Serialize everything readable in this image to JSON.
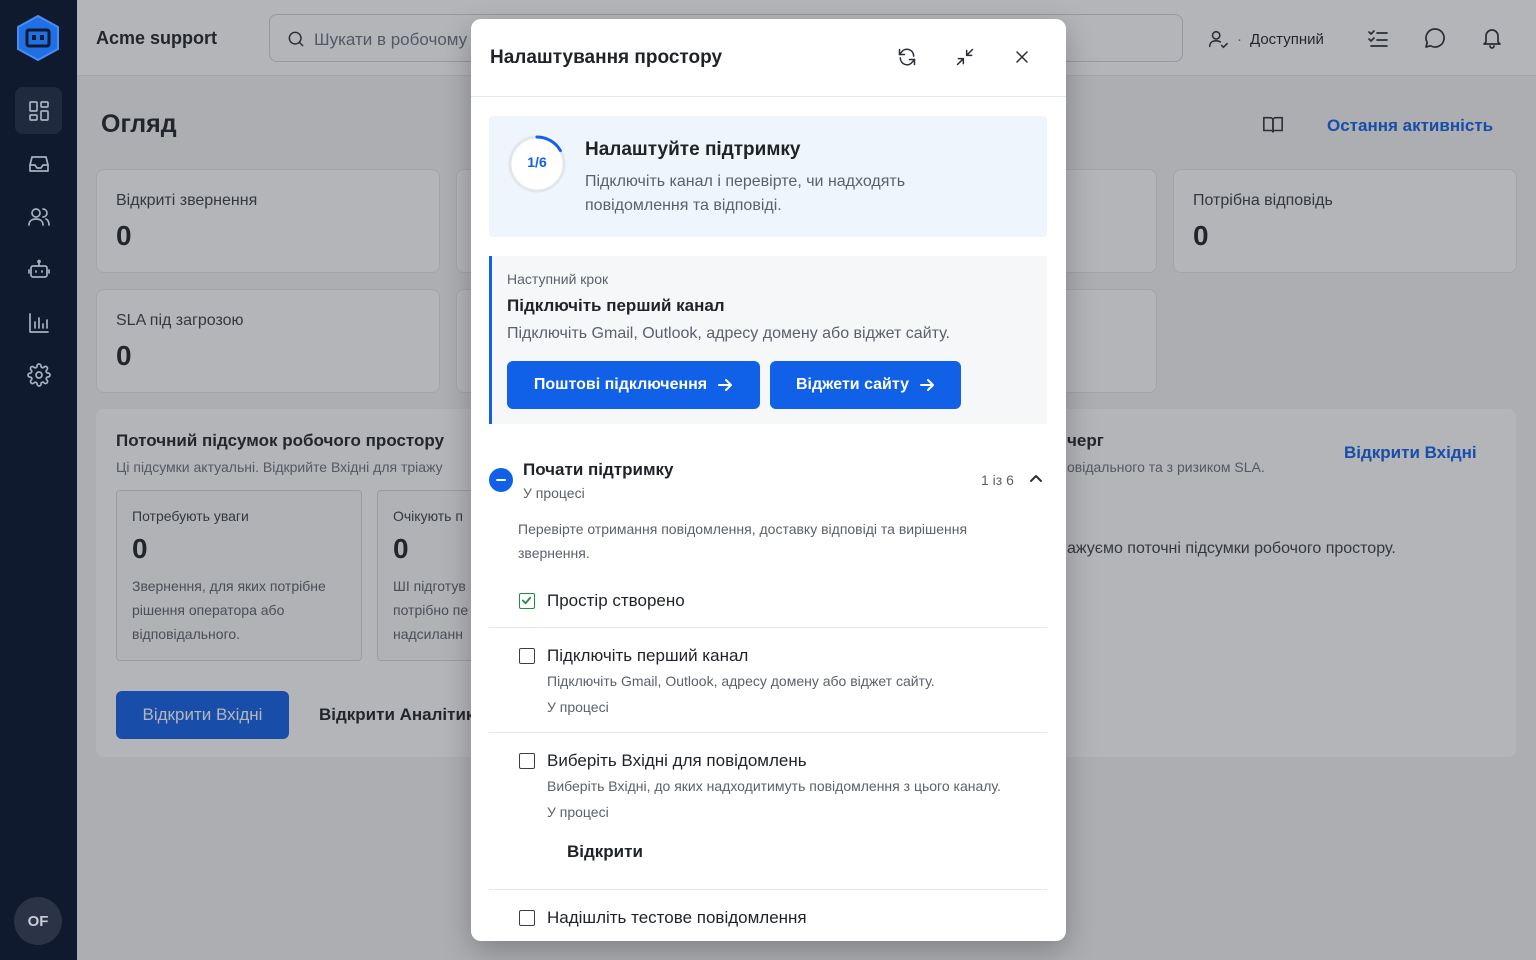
{
  "app": {
    "name": "Acme support",
    "user_initials": "OF"
  },
  "search": {
    "placeholder": "Шукати в робочому просторі"
  },
  "header": {
    "status": "Доступний"
  },
  "page": {
    "title": "Огляд",
    "recent_activity_link": "Остання активність"
  },
  "cards": [
    {
      "label": "Відкриті звернення",
      "value": "0"
    },
    {
      "label": "Потрібна відповідь",
      "value": "0"
    },
    {
      "label": "SLA під загрозою",
      "value": "0"
    }
  ],
  "summary": {
    "title": "Поточний підсумок робочого простору",
    "subtitle": "Ці підсумки актуальні. Відкрийте Вхідні для тріажу",
    "right_title": "черг",
    "right_subtitle": "овідального та з ризиком SLA.",
    "right_text": "ажуємо поточні підсумки робочого простору.",
    "open_inbox_link": "Відкрити Вхідні",
    "minis": [
      {
        "label": "Потребують уваги",
        "value": "0",
        "desc": "Звернення, для яких потрібне рішення оператора або відповідального."
      },
      {
        "label": "Очікують п",
        "value": "0",
        "desc": "ШІ підготув потрібно пе надсиланн"
      }
    ],
    "open_inbox_button": "Відкрити Вхідні",
    "open_analytics_link": "Відкрити Аналітик"
  },
  "modal": {
    "title": "Налаштування простору",
    "progress": {
      "label": "1/6",
      "fraction": 0.1667,
      "title": "Налаштуйте підтримку",
      "desc": "Підключіть канал і перевірте, чи надходять повідомлення та відповіді."
    },
    "next_step": {
      "kicker": "Наступний крок",
      "title": "Підключіть перший канал",
      "desc": "Підключіть Gmail, Outlook, адресу домену або віджет сайту.",
      "btn_mail": "Поштові підключення",
      "btn_widgets": "Віджети сайту"
    },
    "section": {
      "title": "Почати підтримку",
      "status": "У процесі",
      "count": "1 із 6",
      "desc": "Перевірте отримання повідомлення, доставку відповіді та вирішення звернення."
    },
    "tasks": [
      {
        "title": "Простір створено",
        "done": true
      },
      {
        "title": "Підключіть перший канал",
        "desc": "Підключіть Gmail, Outlook, адресу домену або віджет сайту.",
        "status": "У процесі",
        "done": false
      },
      {
        "title": "Виберіть Вхідні для повідомлень",
        "desc": "Виберіть Вхідні, до яких надходитимуть повідомлення з цього каналу.",
        "status": "У процесі",
        "action": "Відкрити",
        "done": false
      },
      {
        "title": "Надішліть тестове повідомлення",
        "done": false
      }
    ]
  },
  "colors": {
    "accent": "#1060e8",
    "sidebar": "#0f1a2e",
    "success": "#1e8e3e"
  },
  "icons": [
    "logo-icon",
    "dashboard-icon",
    "inbox-icon",
    "contacts-icon",
    "bot-icon",
    "analytics-icon",
    "settings-icon",
    "search-icon",
    "user-icon",
    "tasks-icon",
    "chat-icon",
    "bell-icon",
    "book-icon",
    "refresh-icon",
    "collapse-icon",
    "close-icon",
    "arrow-right-icon",
    "chevron-up-icon",
    "check-icon"
  ]
}
